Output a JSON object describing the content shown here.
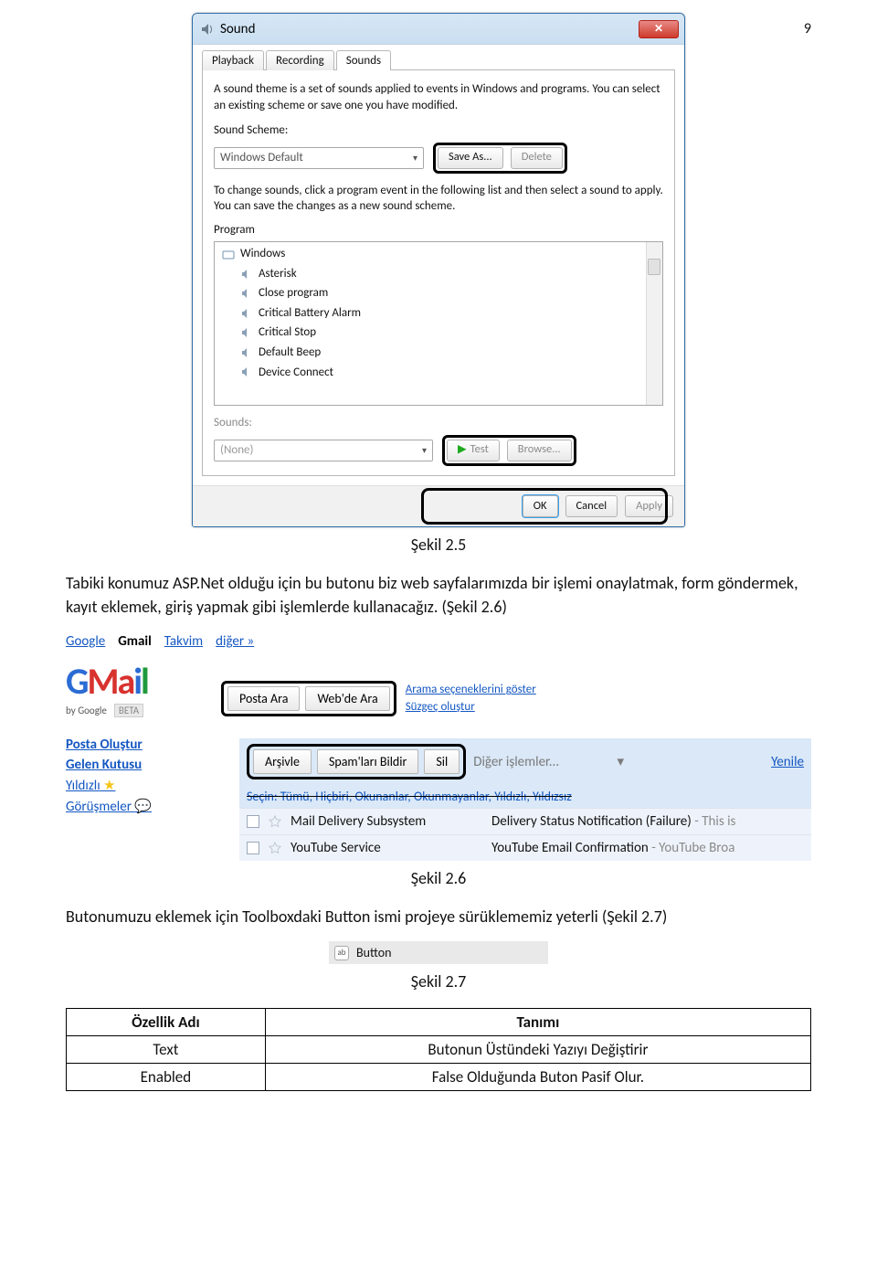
{
  "page_number": "9",
  "sound_dialog": {
    "title": "Sound",
    "tabs": [
      "Playback",
      "Recording",
      "Sounds"
    ],
    "active_tab": 2,
    "intro": "A sound theme is a set of sounds applied to events in Windows and programs. You can select an existing scheme or save one you have modified.",
    "scheme_label": "Sound Scheme:",
    "scheme_value": "Windows Default",
    "save_as": "Save As...",
    "delete": "Delete",
    "change_text": "To change sounds, click a program event in the following list and then select a sound to apply. You can save the changes as a new sound scheme.",
    "program_label": "Program",
    "program_root": "Windows",
    "program_items": [
      "Asterisk",
      "Close program",
      "Critical Battery Alarm",
      "Critical Stop",
      "Default Beep",
      "Device Connect"
    ],
    "sounds_label": "Sounds:",
    "sounds_value": "(None)",
    "test": "Test",
    "browse": "Browse...",
    "ok": "OK",
    "cancel": "Cancel",
    "apply": "Apply"
  },
  "captions": {
    "fig25": "Şekil 2.5",
    "fig26": "Şekil 2.6",
    "fig27": "Şekil 2.7"
  },
  "paragraphs": {
    "p1": "Tabiki konumuz ASP.Net olduğu için bu butonu biz web sayfalarımızda bir işlemi onaylatmak, form göndermek, kayıt eklemek, giriş yapmak gibi işlemlerde kullanacağız. (Şekil 2.6)",
    "p2": "Butonumuzu eklemek için Toolboxdaki Button ismi projeye sürüklememiz yeterli (Şekil 2.7)"
  },
  "gmail": {
    "top_nav": {
      "google": "Google",
      "gmail": "Gmail",
      "takvim": "Takvim",
      "diger": "diğer »"
    },
    "logo_by": "by Google",
    "beta": "BETA",
    "search_buttons": {
      "posta_ara": "Posta Ara",
      "webde_ara": "Web'de Ara"
    },
    "search_side": {
      "l1": "Arama seçeneklerini göster",
      "l2": "Süzgeç oluştur"
    },
    "sidebar": {
      "compose": "Posta Oluştur",
      "inbox": "Gelen Kutusu",
      "starred": "Yıldızlı",
      "chats": "Görüşmeler"
    },
    "toolbar": {
      "arsivle": "Arşivle",
      "spam": "Spam'ları Bildir",
      "sil": "Sil",
      "diger": "Diğer işlemler...",
      "yenile": "Yenile"
    },
    "select_row": "Seçin: Tümü, Hiçbiri, Okunanlar, Okunmayanlar, Yıldızlı, Yıldızsız",
    "rows": [
      {
        "from": "Mail Delivery Subsystem",
        "subj": "Delivery Status Notification (Failure)",
        "subj_gray": " - This is"
      },
      {
        "from": "YouTube Service",
        "subj": "YouTube Email Confirmation",
        "subj_gray": " - YouTube Broa"
      }
    ]
  },
  "toolbox": {
    "button_label": "Button"
  },
  "table": {
    "headers": [
      "Özellik Adı",
      "Tanımı"
    ],
    "rows": [
      [
        "Text",
        "Butonun Üstündeki Yazıyı Değiştirir"
      ],
      [
        "Enabled",
        "False Olduğunda Buton Pasif Olur."
      ]
    ]
  }
}
